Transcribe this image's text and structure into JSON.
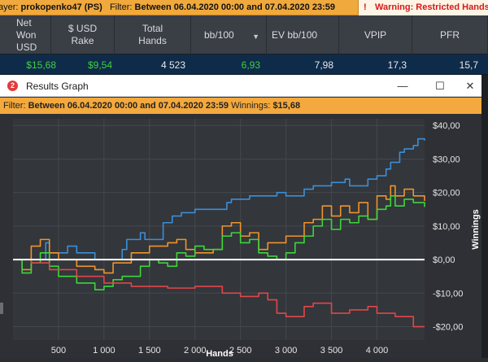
{
  "topbar": {
    "player_label": "ayer:",
    "player_value": "prokopenko47 (PS)",
    "filter_label": "Filter:",
    "filter_value": "Between 06.04.2020 00:00 and 07.04.2020 23:59",
    "warning": "Warning: Restricted Hands",
    "warning_icon": "!"
  },
  "table": {
    "headers": [
      "Net\nWon\nUSD",
      "$ USD\nRake",
      "Total\nHands",
      "bb/100",
      "EV bb/100",
      "VPIP",
      "PFR"
    ],
    "values": [
      "$15,68",
      "$9,54",
      "4 523",
      "6,93",
      "7,98",
      "17,3",
      "15,7"
    ]
  },
  "window": {
    "title": "Results Graph",
    "app_icon": "2",
    "minimize": "—",
    "maximize": "☐",
    "close": "✕",
    "filter_label": "Filter:",
    "filter_value": "Between 06.04.2020 00:00 and 07.04.2020 23:59",
    "winnings_label": "Winnings:",
    "winnings_value": "$15,68"
  },
  "chart_data": {
    "type": "line",
    "xlabel": "Hands",
    "ylabel": "Winnings",
    "xlim": [
      0,
      4523
    ],
    "ylim": [
      -24,
      42
    ],
    "x_ticks": [
      500,
      1000,
      1500,
      2000,
      2500,
      3000,
      3500,
      4000
    ],
    "x_tick_labels": [
      "500",
      "1 000",
      "1 500",
      "2 000",
      "2 500",
      "3 000",
      "3 500",
      "4 000"
    ],
    "y_ticks": [
      40,
      30,
      20,
      10,
      0,
      -10,
      -20
    ],
    "y_tick_labels": [
      "$40,00",
      "$30,00",
      "$20,00",
      "$10,00",
      "$0,00",
      "-$10,00",
      "-$20,00"
    ],
    "grid": true,
    "series": [
      {
        "color": "#3a8fd9",
        "x": [
          0,
          200,
          360,
          400,
          600,
          700,
          900,
          1000,
          1200,
          1250,
          1400,
          1450,
          1650,
          1750,
          1850,
          2000,
          2350,
          2400,
          2600,
          2900,
          3000,
          3200,
          3300,
          3500,
          3650,
          3700,
          3900,
          4000,
          4100,
          4150,
          4250,
          4300,
          4400,
          4450,
          4523
        ],
        "y": [
          0,
          0,
          5,
          2,
          4,
          2,
          0,
          0,
          3,
          6,
          8,
          6,
          11,
          13,
          14,
          15,
          17,
          18,
          19,
          20,
          19,
          21,
          22,
          23,
          24,
          22,
          24,
          25,
          27,
          29,
          32,
          33,
          34,
          36,
          35.5
        ]
      },
      {
        "color": "#f0932b",
        "x": [
          0,
          100,
          200,
          300,
          400,
          500,
          700,
          900,
          1000,
          1100,
          1300,
          1500,
          1700,
          1800,
          1900,
          2000,
          2200,
          2300,
          2400,
          2500,
          2600,
          2700,
          2800,
          3000,
          3200,
          3300,
          3400,
          3500,
          3600,
          3700,
          3800,
          3900,
          4000,
          4100,
          4150,
          4200,
          4300,
          4400,
          4523
        ],
        "y": [
          0,
          -3,
          4,
          6,
          2,
          0,
          -2,
          -3,
          -4,
          -1,
          2,
          4,
          5,
          6,
          3,
          2,
          3,
          10,
          11,
          7,
          8,
          3,
          5,
          7,
          11,
          12,
          16,
          13,
          16,
          14,
          17,
          12,
          19,
          18,
          22,
          19,
          21,
          19,
          17.5
        ]
      },
      {
        "color": "#3cd63c",
        "x": [
          0,
          100,
          200,
          300,
          400,
          500,
          700,
          900,
          1000,
          1100,
          1200,
          1400,
          1500,
          1600,
          1700,
          1800,
          1900,
          2000,
          2100,
          2300,
          2400,
          2500,
          2600,
          2700,
          2800,
          2900,
          3000,
          3100,
          3200,
          3300,
          3400,
          3500,
          3600,
          3700,
          3800,
          3900,
          4000,
          4100,
          4150,
          4200,
          4300,
          4400,
          4523
        ],
        "y": [
          0,
          -4,
          -1,
          2,
          -2,
          -5,
          -7,
          -9,
          -8,
          -6,
          -5,
          -2,
          0,
          -1,
          -2,
          2,
          1,
          4,
          3,
          7,
          8,
          5,
          6,
          2,
          1,
          0,
          2,
          5,
          7,
          10,
          12,
          9,
          12,
          11,
          13,
          12,
          15,
          16,
          19,
          16,
          18,
          17,
          15.7
        ]
      },
      {
        "color": "#e0474a",
        "x": [
          0,
          200,
          400,
          700,
          1000,
          1300,
          1700,
          2000,
          2300,
          2500,
          2700,
          2800,
          2900,
          3000,
          3200,
          3300,
          3500,
          3700,
          3800,
          3900,
          4000,
          4200,
          4400,
          4523
        ],
        "y": [
          0,
          -1,
          -3,
          -5,
          -7,
          -8,
          -8.5,
          -8,
          -10,
          -11,
          -10,
          -12,
          -16,
          -17,
          -14,
          -13,
          -16,
          -15,
          -15,
          -14,
          -16,
          -17,
          -20,
          -20
        ]
      },
      {
        "color": "#ffffff",
        "x": [
          0,
          4523
        ],
        "y": [
          0,
          0
        ]
      }
    ]
  }
}
